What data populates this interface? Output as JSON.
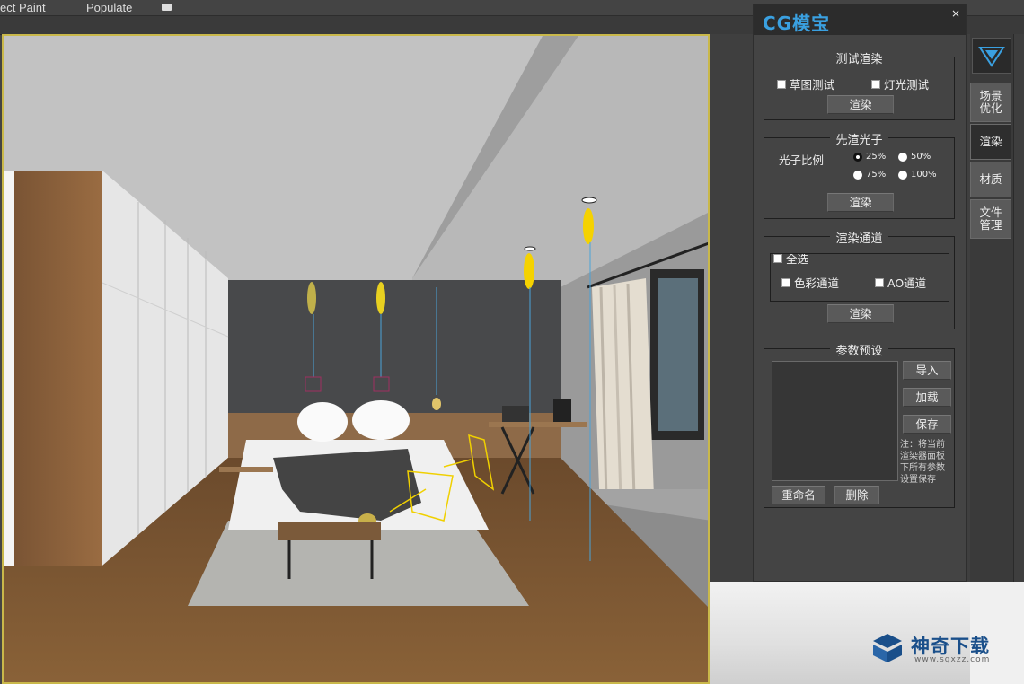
{
  "menubar": {
    "item1": "ect Paint",
    "item2": "Populate"
  },
  "panel": {
    "logo_text": "CG模宝",
    "close": "×",
    "test_render": {
      "title": "测试渲染",
      "draft_test": "草图测试",
      "light_test": "灯光测试",
      "render_btn": "渲染"
    },
    "photon": {
      "title": "先渲光子",
      "ratio_label": "光子比例",
      "opt_25": "25%",
      "opt_50": "50%",
      "opt_75": "75%",
      "opt_100": "100%",
      "selected": "25%",
      "render_btn": "渲染"
    },
    "channels": {
      "title": "渲染通道",
      "select_all": "全选",
      "color_channel": "色彩通道",
      "ao_channel": "AO通道",
      "render_btn": "渲染"
    },
    "presets": {
      "title": "参数预设",
      "import_btn": "导入",
      "load_btn": "加载",
      "save_btn": "保存",
      "note": "注：将当前渲染器面板下所有参数设置保存",
      "rename_btn": "重命名",
      "delete_btn": "删除"
    }
  },
  "sidetabs": {
    "scene_opt": "场景优化",
    "render": "渲染",
    "material": "材质",
    "file_mgmt": "文件管理"
  },
  "watermark": {
    "title": "神奇下载",
    "url": "www.sqxzz.com"
  }
}
